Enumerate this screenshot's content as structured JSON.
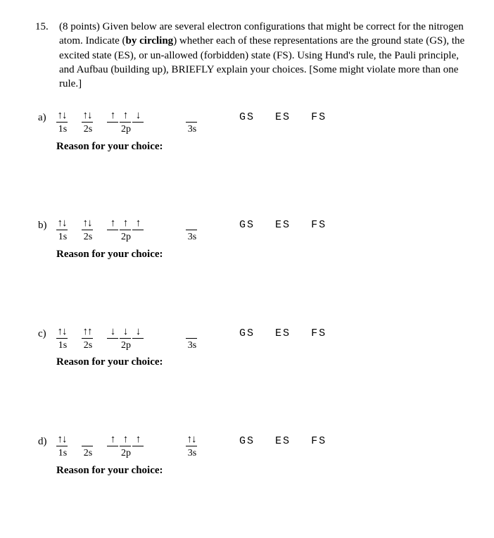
{
  "question": {
    "number": "15.",
    "points": "(8 points)",
    "intro": "Given below are several electron configurations that might be correct for the nitrogen atom.  Indicate (",
    "bold1": "by circling",
    "intro2": ") whether each of these representations are the ground state (GS), the excited state (ES), or un-allowed (forbidden) state (FS).  Using Hund's rule, the Pauli principle, and Aufbau (building up), BRIEFLY explain your choices.  [Some might violate more than one rule.]"
  },
  "orbital_labels": {
    "s1": "1s",
    "s2": "2s",
    "p2": "2p",
    "s3": "3s"
  },
  "state_labels": {
    "gs": "GS",
    "es": "ES",
    "fs": "FS"
  },
  "reason_label": "Reason for your choice:",
  "parts": {
    "a": {
      "label": "a)",
      "o1s": "↑↓",
      "o2s": "↑↓",
      "o2p_1": "↑",
      "o2p_2": "↑",
      "o2p_3": "↓",
      "o3s": ""
    },
    "b": {
      "label": "b)",
      "o1s": "↑↓",
      "o2s": "↑↓",
      "o2p_1": "↑",
      "o2p_2": "↑",
      "o2p_3": "↑",
      "o3s": ""
    },
    "c": {
      "label": "c)",
      "o1s": "↑↓",
      "o2s": "↑↑",
      "o2p_1": "↓",
      "o2p_2": "↓",
      "o2p_3": "↓",
      "o3s": ""
    },
    "d": {
      "label": "d)",
      "o1s": "↑↓",
      "o2s": "",
      "o2p_1": "↑",
      "o2p_2": "↑",
      "o2p_3": "↑",
      "o3s": "↑↓"
    }
  }
}
